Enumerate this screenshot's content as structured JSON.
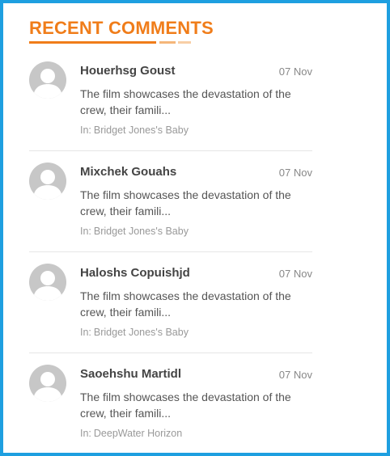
{
  "widget": {
    "title": "RECENT COMMENTS",
    "accent_color": "#f07d1a",
    "border_color": "#1e9fe0"
  },
  "comments": [
    {
      "avatar_icon": "default-user-avatar",
      "author": "Houerhsg Goust",
      "date": "07 Nov",
      "excerpt": "The film showcases the devastation of the crew, their famili...",
      "post_prefix": "In:",
      "post_title": "Bridget Jones's Baby"
    },
    {
      "avatar_icon": "default-user-avatar",
      "author": "Mixchek Gouahs",
      "date": "07 Nov",
      "excerpt": "The film showcases the devastation of the crew, their famili...",
      "post_prefix": "In:",
      "post_title": "Bridget Jones's Baby"
    },
    {
      "avatar_icon": "default-user-avatar",
      "author": "Haloshs Copuishjd",
      "date": "07 Nov",
      "excerpt": "The film showcases the devastation of the crew, their famili...",
      "post_prefix": "In:",
      "post_title": "Bridget Jones's Baby"
    },
    {
      "avatar_icon": "default-user-avatar",
      "author": "Saoehshu Martidl",
      "date": "07 Nov",
      "excerpt": "The film showcases the devastation of the crew, their famili...",
      "post_prefix": "In:",
      "post_title": "DeepWater Horizon"
    }
  ]
}
